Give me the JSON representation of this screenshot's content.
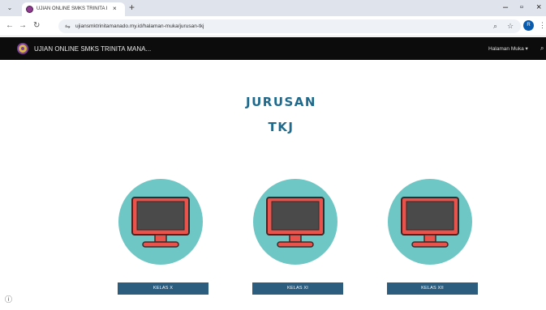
{
  "browser": {
    "tab_title": "UJIAN ONLINE SMKS TRINITA I",
    "tab_close": "×",
    "new_tab": "+",
    "url": "ujiansmktrinitamanado.my.id/halaman-muka/jurusan-tkj",
    "profile_initial": "R"
  },
  "site": {
    "title": "UJIAN ONLINE SMKS TRINITA MANA...",
    "nav_menu_label": "Halaman Muka ▾"
  },
  "page": {
    "heading": "JURUSAN",
    "subheading": "TKJ"
  },
  "classes": [
    {
      "label": "KELAS X"
    },
    {
      "label": "KELAS XI"
    },
    {
      "label": "KELAS XII"
    }
  ],
  "icons": {
    "monitor": "monitor-icon",
    "circle_color": "#6fc7c5",
    "monitor_body_color": "#e9534b",
    "screen_color": "#4a4a4a"
  },
  "colors": {
    "heading": "#1f6a8c",
    "button": "#2c5d7f",
    "navbar": "#0c0c0c"
  }
}
